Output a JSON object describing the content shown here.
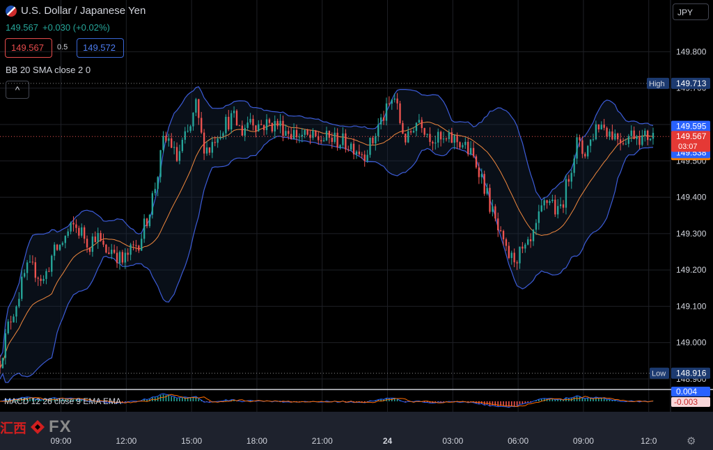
{
  "header": {
    "title": "U.S. Dollar / Japanese Yen",
    "last": "149.567",
    "change": "+0.030 (+0.02%)",
    "sell_price": "149.567",
    "buy_price": "149.572",
    "spread": "0.5",
    "indicator_label": "BB 20 SMA close 2 0",
    "currency": "JPY",
    "collapse_glyph": "^"
  },
  "macd": {
    "label": "MACD 12 26 close 9 EMA EMA",
    "values": [
      "0.004",
      "-0.003"
    ]
  },
  "logo": {
    "cn": "汇西",
    "fx": "FX"
  },
  "colors": {
    "up": "#26a69a",
    "down": "#ef5350",
    "bb": "#3c5cd8",
    "sma": "#f0883e",
    "grid": "#1e2026",
    "axis_text": "#d1d4dc",
    "hline": "#888888"
  },
  "chart_data": {
    "type": "candlestick",
    "title": "U.S. Dollar / Japanese Yen",
    "y_ticks": [
      "149.800",
      "149.700",
      "149.600",
      "149.500",
      "149.400",
      "149.300",
      "149.200",
      "149.100",
      "149.000",
      "148.900"
    ],
    "ylim": [
      148.875,
      149.885
    ],
    "x_ticks": [
      {
        "label": "09:00",
        "h": 9
      },
      {
        "label": "12:00",
        "h": 12
      },
      {
        "label": "15:00",
        "h": 15
      },
      {
        "label": "18:00",
        "h": 18
      },
      {
        "label": "21:00",
        "h": 21
      },
      {
        "label": "24",
        "h": 24,
        "bold": true
      },
      {
        "label": "03:00",
        "h": 27
      },
      {
        "label": "06:00",
        "h": 30
      },
      {
        "label": "09:00",
        "h": 33
      },
      {
        "label": "12:0",
        "h": 36
      }
    ],
    "xlim_hours": [
      6.2,
      37.0
    ],
    "high": {
      "label": "High",
      "value": 149.713,
      "text": "149.713"
    },
    "low": {
      "label": "Low",
      "value": 148.916,
      "text": "148.916"
    },
    "current": {
      "value": 149.567,
      "text": "149.567",
      "countdown": "03:07"
    },
    "bb_upper": {
      "value": 149.595,
      "text": "149.595"
    },
    "bb_lower": {
      "value": 149.538,
      "text": "149.538"
    },
    "sma_value": {
      "value": 149.567,
      "text": "149.567"
    },
    "price_path": [
      [
        6.2,
        148.95
      ],
      [
        6.6,
        149.05
      ],
      [
        7.0,
        149.12
      ],
      [
        7.4,
        149.2
      ],
      [
        7.8,
        149.2
      ],
      [
        8.2,
        149.17
      ],
      [
        8.6,
        149.24
      ],
      [
        9.0,
        149.27
      ],
      [
        9.3,
        149.3
      ],
      [
        9.6,
        149.32
      ],
      [
        10.0,
        149.3
      ],
      [
        10.3,
        149.27
      ],
      [
        10.6,
        149.3
      ],
      [
        11.0,
        149.25
      ],
      [
        11.4,
        149.26
      ],
      [
        11.8,
        149.22
      ],
      [
        12.2,
        149.25
      ],
      [
        12.6,
        149.28
      ],
      [
        13.0,
        149.35
      ],
      [
        13.4,
        149.45
      ],
      [
        13.7,
        149.55
      ],
      [
        14.0,
        149.56
      ],
      [
        14.3,
        149.5
      ],
      [
        14.6,
        149.55
      ],
      [
        14.9,
        149.58
      ],
      [
        15.2,
        149.65
      ],
      [
        15.5,
        149.55
      ],
      [
        15.8,
        149.53
      ],
      [
        16.1,
        149.57
      ],
      [
        16.5,
        149.6
      ],
      [
        16.9,
        149.62
      ],
      [
        17.3,
        149.58
      ],
      [
        17.7,
        149.62
      ],
      [
        18.0,
        149.6
      ],
      [
        18.5,
        149.6
      ],
      [
        19.0,
        149.6
      ],
      [
        19.5,
        149.58
      ],
      [
        20.0,
        149.57
      ],
      [
        20.5,
        149.56
      ],
      [
        21.0,
        149.56
      ],
      [
        21.5,
        149.56
      ],
      [
        22.0,
        149.55
      ],
      [
        22.5,
        149.54
      ],
      [
        22.9,
        149.52
      ],
      [
        23.3,
        149.55
      ],
      [
        23.6,
        149.6
      ],
      [
        24.0,
        149.64
      ],
      [
        24.3,
        149.68
      ],
      [
        24.6,
        149.6
      ],
      [
        24.9,
        149.55
      ],
      [
        25.2,
        149.6
      ],
      [
        25.5,
        149.62
      ],
      [
        25.8,
        149.58
      ],
      [
        26.2,
        149.56
      ],
      [
        26.6,
        149.55
      ],
      [
        27.0,
        149.56
      ],
      [
        27.4,
        149.55
      ],
      [
        27.8,
        149.52
      ],
      [
        28.2,
        149.48
      ],
      [
        28.6,
        149.4
      ],
      [
        29.0,
        149.32
      ],
      [
        29.4,
        149.25
      ],
      [
        29.7,
        149.23
      ],
      [
        30.0,
        149.24
      ],
      [
        30.3,
        149.25
      ],
      [
        30.6,
        149.27
      ],
      [
        30.9,
        149.33
      ],
      [
        31.2,
        149.38
      ],
      [
        31.5,
        149.4
      ],
      [
        31.8,
        149.35
      ],
      [
        32.1,
        149.4
      ],
      [
        32.4,
        149.48
      ],
      [
        32.7,
        149.55
      ],
      [
        33.0,
        149.52
      ],
      [
        33.3,
        149.55
      ],
      [
        33.6,
        149.6
      ],
      [
        33.9,
        149.6
      ],
      [
        34.2,
        149.58
      ],
      [
        34.5,
        149.57
      ],
      [
        34.8,
        149.56
      ],
      [
        35.1,
        149.57
      ],
      [
        35.4,
        149.58
      ],
      [
        35.7,
        149.56
      ],
      [
        36.0,
        149.57
      ],
      [
        36.3,
        149.567
      ]
    ]
  }
}
